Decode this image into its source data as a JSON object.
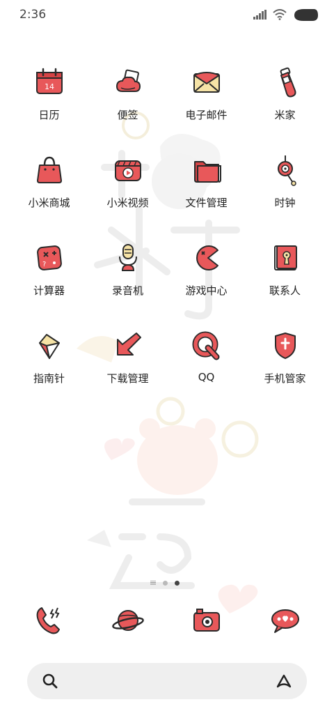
{
  "status_bar": {
    "time": "2:36",
    "icons": [
      "signal-icon",
      "wifi-icon",
      "battery-icon"
    ]
  },
  "apps": [
    {
      "label": "日历",
      "icon": "calendar-icon",
      "badge_text": "14"
    },
    {
      "label": "便签",
      "icon": "notes-icon"
    },
    {
      "label": "电子邮件",
      "icon": "email-icon"
    },
    {
      "label": "米家",
      "icon": "mijia-icon"
    },
    {
      "label": "小米商城",
      "icon": "shopping-bag-icon"
    },
    {
      "label": "小米视频",
      "icon": "video-icon"
    },
    {
      "label": "文件管理",
      "icon": "folder-icon"
    },
    {
      "label": "时钟",
      "icon": "clock-icon"
    },
    {
      "label": "计算器",
      "icon": "calculator-icon"
    },
    {
      "label": "录音机",
      "icon": "microphone-icon"
    },
    {
      "label": "游戏中心",
      "icon": "game-center-icon"
    },
    {
      "label": "联系人",
      "icon": "contacts-book-icon"
    },
    {
      "label": "指南针",
      "icon": "compass-icon"
    },
    {
      "label": "下载管理",
      "icon": "download-arrow-icon"
    },
    {
      "label": "QQ",
      "icon": "qq-icon"
    },
    {
      "label": "手机管家",
      "icon": "security-shield-icon"
    }
  ],
  "page_indicator": {
    "pages": 2,
    "current": 2
  },
  "dock": [
    {
      "icon": "phone-icon"
    },
    {
      "icon": "browser-planet-icon"
    },
    {
      "icon": "camera-icon"
    },
    {
      "icon": "messages-icon"
    }
  ],
  "search_bar": {
    "icons": [
      "search-icon",
      "assistant-icon"
    ]
  },
  "colors": {
    "accent_red": "#e8585a",
    "outline": "#2a2a2a",
    "cream": "#f6e3a6",
    "background": "#ffffff"
  }
}
